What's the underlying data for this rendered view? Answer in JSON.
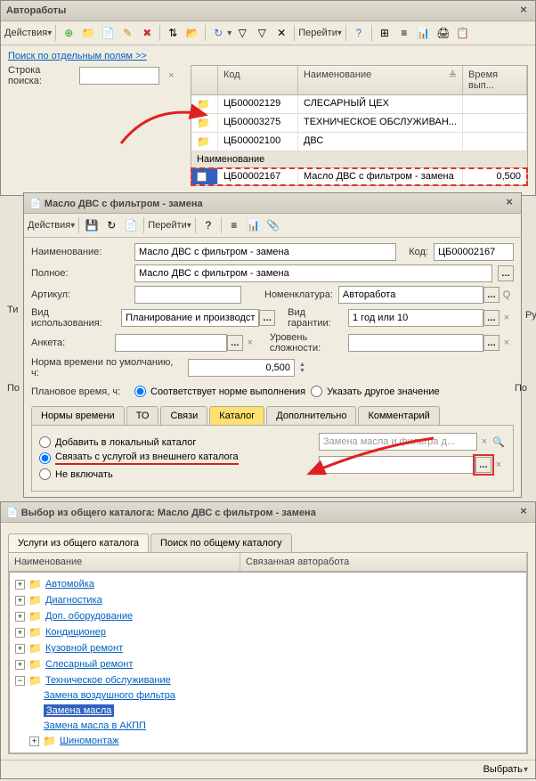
{
  "win1": {
    "title": "Автоработы",
    "actions": "Действия",
    "search_link": "Поиск по отдельным полям >>",
    "search_label": "Строка поиска:",
    "col_code": "Код",
    "col_name": "Наименование",
    "col_time": "Время вып...",
    "goto": "Перейти",
    "rows": [
      {
        "code": "ЦБ00002129",
        "name": "СЛЕСАРНЫЙ ЦЕХ"
      },
      {
        "code": "ЦБ00003275",
        "name": "ТЕХНИЧЕСКОЕ ОБСЛУЖИВАН..."
      },
      {
        "code": "ЦБ00002100",
        "name": "ДВС"
      },
      {
        "code": "ЦБ00002167",
        "name": "Масло ДВС с фильтром - замена",
        "time": "0,500"
      }
    ]
  },
  "win2": {
    "title": "Масло ДВС с фильтром - замена",
    "actions": "Действия",
    "goto": "Перейти",
    "lbl_name": "Наименование:",
    "val_name": "Масло ДВС с фильтром - замена",
    "lbl_code": "Код:",
    "val_code": "ЦБ00002167",
    "lbl_full": "Полное:",
    "val_full": "Масло ДВС с фильтром - замена",
    "lbl_article": "Артикул:",
    "lbl_nomen": "Номенклатура:",
    "val_nomen": "Авторабота",
    "lbl_usage": "Вид использования:",
    "val_usage": "Планирование и производство",
    "lbl_warr": "Вид гарантии:",
    "val_warr": "1 год или 10",
    "lbl_anketa": "Анкета:",
    "lbl_level": "Уровень сложности:",
    "lbl_norm": "Норма времени по умолчанию, ч:",
    "val_norm": "0,500",
    "lbl_plan": "Плановое время, ч:",
    "radio_norm": "Соответствует норме выполнения",
    "radio_other": "Указать другое значение",
    "tabs": [
      "Нормы времени",
      "ТО",
      "Связи",
      "Каталог",
      "Дополнительно",
      "Комментарий"
    ],
    "radio_add": "Добавить в локальный каталог",
    "radio_link": "Связать с услугой из внешнего каталога",
    "radio_skip": "Не включать",
    "search_hint": "Замена масла и фильтра д..."
  },
  "win3": {
    "title": "Выбор из общего каталога: Масло ДВС с фильтром - замена",
    "tab1": "Услуги из общего каталога",
    "tab2": "Поиск по общему каталогу",
    "col_name": "Наименование",
    "col_linked": "Связанная авторабота",
    "tree": [
      "Автомойка",
      "Диагностика",
      "Доп. оборудование",
      "Кондиционер",
      "Кузовной ремонт",
      "Слесарный ремонт",
      "Техническое обслуживание"
    ],
    "sub": [
      "Замена воздушного фильтра",
      "Замена масла",
      "Замена масла в АКПП",
      "Шиномонтаж"
    ],
    "select_btn": "Выбрать"
  },
  "misc": {
    "rub": "Руб",
    "ti": "Ти",
    "po": "По",
    "po2": "По"
  }
}
